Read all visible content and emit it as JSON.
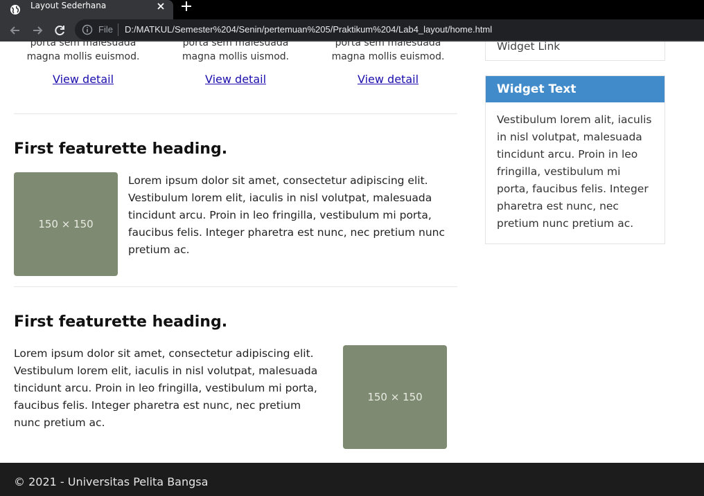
{
  "browser": {
    "tab_title": "Layout Sederhana",
    "scheme_label": "File",
    "url": "D:/MATKUL/Semester%204/Senin/pertemuan%205/Praktikum%204/Lab4_layout/home.html"
  },
  "columns": [
    {
      "text": "porta sem malesuada magna mollis euismod.",
      "link": "View detail"
    },
    {
      "text": "porta sem malesuada magna mollis uismod.",
      "link": "View detail"
    },
    {
      "text": "porta sem malesuada magna mollis euismod.",
      "link": "View detail"
    }
  ],
  "featurettes": [
    {
      "heading": "First featurette heading.",
      "text": "Lorem ipsum dolor sit amet, consectetur adipiscing elit. Vestibulum lorem elit, iaculis in nisl volutpat, malesuada tincidunt arcu. Proin in leo fringilla, vestibulum mi porta, faucibus felis. Integer pharetra est nunc, nec pretium nunc pretium ac.",
      "image_label": "150 × 150"
    },
    {
      "heading": "First featurette heading.",
      "text": "Lorem ipsum dolor sit amet, consectetur adipiscing elit. Vestibulum lorem elit, iaculis in nisl volutpat, malesuada tincidunt arcu. Proin in leo fringilla, vestibulum mi porta, faucibus felis. Integer pharetra est nunc, nec pretium nunc pretium ac.",
      "image_label": "150 × 150"
    }
  ],
  "sidebar": {
    "widget_link": "Widget Link",
    "widget_text_title": "Widget Text",
    "widget_text_body": "Vestibulum lorem alit, iaculis in nisl volutpat, malesuada tincidunt arcu. Proin in leo fringilla, vestibulum mi porta, faucibus felis. Integer pharetra est nunc, nec pretium nunc pretium ac."
  },
  "footer": {
    "text": "© 2021 - Universitas Pelita Bangsa"
  },
  "colors": {
    "widget_header": "#428bca",
    "placeholder": "#7f8a72",
    "footer": "#1c1c1c",
    "link": "#1a0dab"
  }
}
